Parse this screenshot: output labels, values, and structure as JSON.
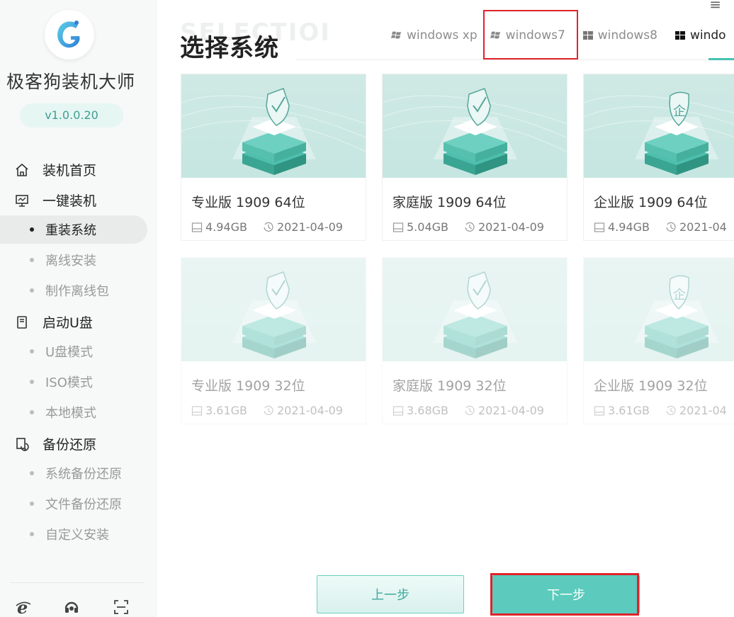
{
  "app": {
    "title": "极客狗装机大师",
    "version": "v1.0.0.20"
  },
  "window_controls": {
    "menu_glyph": "≡"
  },
  "sidebar": {
    "groups": [
      {
        "label": "装机首页",
        "icon": "home-icon"
      },
      {
        "label": "一键装机",
        "icon": "monitor-icon"
      },
      {
        "label": "启动U盘",
        "icon": "usb-drive-icon"
      },
      {
        "label": "备份还原",
        "icon": "backup-icon"
      }
    ],
    "sub_items": [
      {
        "label": "重装系统",
        "active": true
      },
      {
        "label": "离线安装",
        "active": false
      },
      {
        "label": "制作离线包",
        "active": false
      },
      {
        "label": "U盘模式",
        "active": false
      },
      {
        "label": "ISO模式",
        "active": false
      },
      {
        "label": "本地模式",
        "active": false
      },
      {
        "label": "系统备份还原",
        "active": false
      },
      {
        "label": "文件备份还原",
        "active": false
      },
      {
        "label": "自定义安装",
        "active": false
      }
    ],
    "bottom_icons": [
      "ie-browser-icon",
      "customer-service-icon",
      "scan-icon"
    ]
  },
  "main": {
    "ghost_text": "SELECTIOI",
    "title": "选择系统",
    "tabs": [
      {
        "label": "windows xp",
        "icon": "windows-xp-icon"
      },
      {
        "label": "windows7",
        "icon": "windows-xp-icon"
      },
      {
        "label": "windows8",
        "icon": "windows-tiles-icon"
      },
      {
        "label": "windo",
        "icon": "windows-tiles-icon"
      }
    ],
    "cards": [
      {
        "name": "专业版 1909 64位",
        "size": "4.94GB",
        "date": "2021-04-09",
        "badge": "check"
      },
      {
        "name": "家庭版 1909 64位",
        "size": "5.04GB",
        "date": "2021-04-09",
        "badge": "check"
      },
      {
        "name": "企业版 1909 64位",
        "size": "4.94GB",
        "date": "2021-04",
        "badge": "企"
      },
      {
        "name": "专业版 1909 32位",
        "size": "3.61GB",
        "date": "2021-04-09",
        "badge": "check"
      },
      {
        "name": "家庭版 1909 32位",
        "size": "3.68GB",
        "date": "2021-04-09",
        "badge": "check"
      },
      {
        "name": "企业版 1909 32位",
        "size": "3.61GB",
        "date": "2021-04",
        "badge": "企"
      }
    ],
    "prev_label": "上一步",
    "next_label": "下一步"
  },
  "colors": {
    "accent": "#5ccbbd",
    "highlight": "#e0232a",
    "tab_underline": "#46c2b4"
  }
}
